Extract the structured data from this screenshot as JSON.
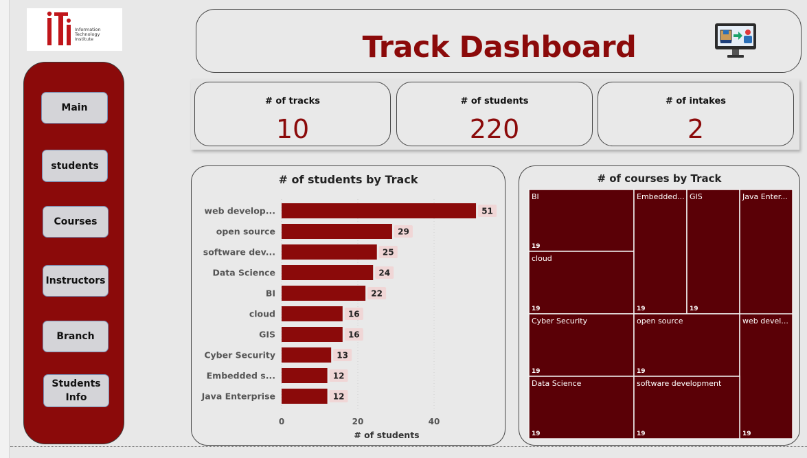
{
  "logo": {
    "letters": "iti",
    "text": "Information\nTechnology\nInstitute"
  },
  "nav": [
    {
      "label": "Main"
    },
    {
      "label": "students"
    },
    {
      "label": "Courses"
    },
    {
      "label": "Instructors"
    },
    {
      "label": "Branch"
    },
    {
      "label": "Students\nInfo"
    }
  ],
  "header": {
    "title": "Track Dashboard",
    "icon": "monitor-transfer-icon"
  },
  "kpis": [
    {
      "label": "# of tracks",
      "value": "10"
    },
    {
      "label": "# of students",
      "value": "220"
    },
    {
      "label": "# of intakes",
      "value": "2"
    }
  ],
  "colors": {
    "accent": "#8b0a0a",
    "treemap": "#5a0006",
    "label_bg": "#f0d6d6"
  },
  "chart_data": [
    {
      "type": "bar",
      "orientation": "horizontal",
      "title": "# of students by Track",
      "xlabel": "# of students",
      "ylabel": "",
      "categories": [
        "web develop...",
        "open source",
        "software dev...",
        "Data Science",
        "BI",
        "cloud",
        "GIS",
        "Cyber Security",
        "Embedded s...",
        "Java Enterprise"
      ],
      "values": [
        51,
        29,
        25,
        24,
        22,
        16,
        16,
        13,
        12,
        12
      ],
      "xlim": [
        0,
        55
      ],
      "xticks": [
        0,
        20,
        40
      ],
      "grid": true
    },
    {
      "type": "treemap",
      "title": "# of courses by Track",
      "items": [
        {
          "name": "BI",
          "value": 19
        },
        {
          "name": "cloud",
          "value": 19
        },
        {
          "name": "Embedded...",
          "value": 19
        },
        {
          "name": "GIS",
          "value": 19
        },
        {
          "name": "Java Enter...",
          "value": 19
        },
        {
          "name": "Cyber Security",
          "value": 19
        },
        {
          "name": "open source",
          "value": 19
        },
        {
          "name": "web devel...",
          "value": 19
        },
        {
          "name": "Data Science",
          "value": 19
        },
        {
          "name": "software development",
          "value": 19
        }
      ]
    }
  ]
}
